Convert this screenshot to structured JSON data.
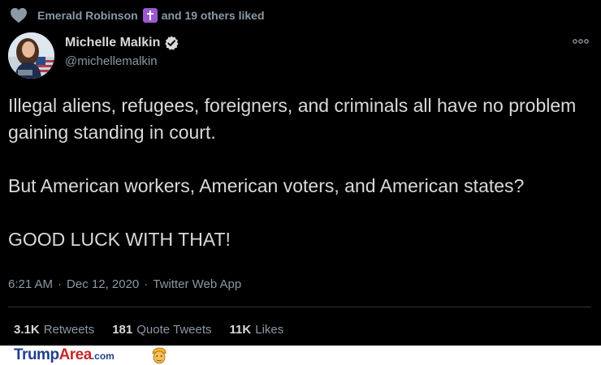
{
  "social_context": {
    "icon": "heart-icon",
    "name": "Emerald Robinson",
    "badge_icon": "latin-cross-icon",
    "suffix": "and 19 others liked"
  },
  "author": {
    "name": "Michelle Malkin",
    "verified_icon": "verified-badge-icon",
    "handle": "@michellemalkin"
  },
  "more_icon": "more-options-icon",
  "tweet": {
    "paragraphs": [
      "Illegal aliens, refugees, foreigners, and criminals all have no problem gaining standing in court.",
      "But American workers, American voters, and American states?",
      "GOOD LUCK WITH THAT!"
    ]
  },
  "meta": {
    "time": "6:21 AM",
    "separator": "·",
    "date": "Dec 12, 2020",
    "source": "Twitter Web App"
  },
  "stats": {
    "retweets": {
      "count": "3.1K",
      "label": "Retweets"
    },
    "quote_tweets": {
      "count": "181",
      "label": "Quote Tweets"
    },
    "likes": {
      "count": "11K",
      "label": "Likes"
    }
  },
  "watermark": {
    "part1": "Trump",
    "part2": "Area",
    "part3": ".com",
    "icon": "trump-face-icon"
  },
  "colors": {
    "background": "#000000",
    "text_primary": "#d9d9d9",
    "text_secondary": "#8b98a5",
    "verified": "#d9d9d9",
    "divider": "#2f3336",
    "badge": "#9b59d0"
  }
}
